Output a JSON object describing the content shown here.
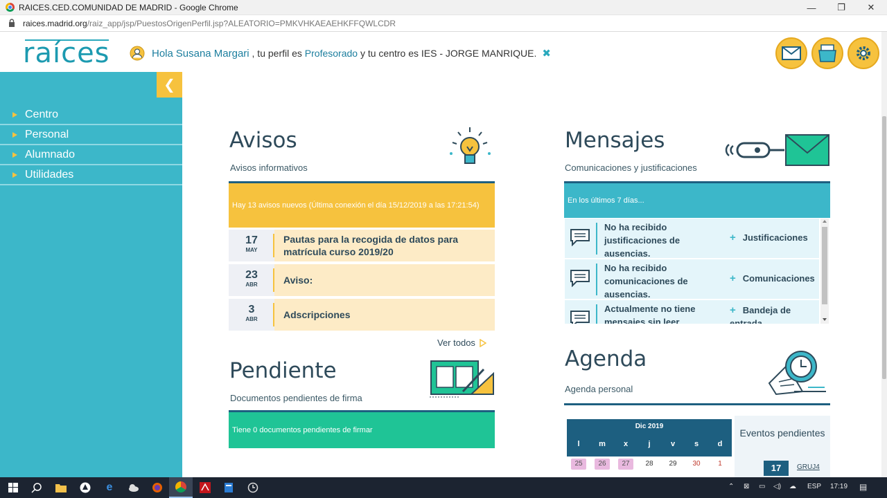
{
  "window": {
    "title": "RAICES.CED.COMUNIDAD DE MADRID - Google Chrome",
    "controls": {
      "minimize": "—",
      "maximize": "❐",
      "close": "✕"
    }
  },
  "address": {
    "domain": "raices.madrid.org",
    "path": "/raiz_app/jsp/PuestosOrigenPerfil.jsp?ALEATORIO=PMKVHKAEAEHKFFQWLCDR"
  },
  "header": {
    "logo": "raíces",
    "greeting_prefix": "Hola",
    "user_name": "Susana Margari",
    "profile_text": ", tu perfil es",
    "profile": "Profesorado",
    "center_text": "y tu centro es IES - JORGE MANRIQUE.",
    "close_glyph": "✖",
    "icons": [
      "envelope-icon",
      "folder-icon",
      "gear-icon"
    ]
  },
  "sidebar": {
    "collapse_glyph": "❮",
    "items": [
      {
        "label": "Centro"
      },
      {
        "label": "Personal"
      },
      {
        "label": "Alumnado"
      },
      {
        "label": "Utilidades"
      }
    ]
  },
  "avisos": {
    "title": "Avisos",
    "subtitle": "Avisos informativos",
    "banner": "Hay 13 avisos nuevos (Última conexión el día 15/12/2019 a las 17:21:54)",
    "rows": [
      {
        "day": "17",
        "month": "MAY",
        "text": "Pautas para la recogida de datos para matrícula curso 2019/20"
      },
      {
        "day": "23",
        "month": "ABR",
        "text": "Aviso:"
      },
      {
        "day": "3",
        "month": "ABR",
        "text": "Adscripciones"
      }
    ],
    "see_all": "Ver todos"
  },
  "mensajes": {
    "title": "Mensajes",
    "subtitle": "Comunicaciones y justificaciones",
    "banner": "En los últimos 7 días...",
    "rows": [
      {
        "text": "No ha recibido justificaciones de ausencias.",
        "link": "Justificaciones"
      },
      {
        "text": "No ha recibido comunicaciones de ausencias.",
        "link": "Comunicaciones"
      },
      {
        "text": "Actualmente no tiene mensajes sin leer",
        "link": "Bandeja de entrada"
      }
    ]
  },
  "pendiente": {
    "title": "Pendiente",
    "subtitle": "Documentos pendientes de firma",
    "banner": "Tiene 0 documentos pendientes de firmar"
  },
  "agenda": {
    "title": "Agenda",
    "subtitle": "Agenda personal",
    "calendar": {
      "month": "Dic 2019",
      "weekdays": [
        "l",
        "m",
        "x",
        "j",
        "v",
        "s",
        "d"
      ],
      "first_row": [
        "25",
        "26",
        "27",
        "28",
        "29",
        "30",
        "1"
      ]
    },
    "events_label": "Eventos pendientes",
    "events_count": "17",
    "events_group": "GRUJ4"
  },
  "taskbar": {
    "lang": "ESP",
    "time": "17:19"
  },
  "colors": {
    "sidebar": "#3cb7c9",
    "accent_yellow": "#f6c23e",
    "avisos_banner": "#f6c23e",
    "mensajes_banner": "#3cb7c9",
    "pendiente_banner": "#1fc496",
    "dark_blue": "#1d5f80"
  }
}
